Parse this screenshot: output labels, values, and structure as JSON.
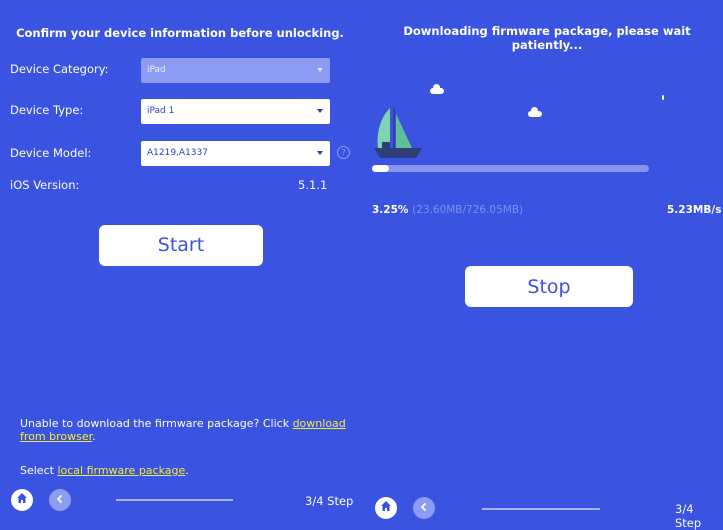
{
  "left_panel": {
    "heading": "Confirm your device information before unlocking.",
    "fields": [
      {
        "label": "Device Category:",
        "value": "iPad"
      },
      {
        "label": "Device Type:",
        "value": "iPad 1"
      },
      {
        "label": "Device Model:",
        "value": "A1219,A1337"
      }
    ],
    "ios_label": "iOS Version:",
    "ios_value": "5.1.1",
    "start_label": "Start",
    "note_prefix": "Unable to download the firmware package? Click ",
    "note_link": "download from browser",
    "note_suffix": ".",
    "select_prefix": "Select ",
    "select_link": "local firmware package",
    "select_suffix": ".",
    "step": "3/4 Step"
  },
  "right_panel": {
    "heading": "Downloading firmware package, please wait patiently...",
    "progress_fraction": 0.0325,
    "percent": "3.25%",
    "size": "(23.60MB/726.05MB)",
    "speed": "5.23MB/s",
    "stop_label": "Stop",
    "step": "3/4 Step"
  },
  "icons": {
    "home": "home-icon",
    "back": "back-chevron-icon",
    "help": "question-circle-icon",
    "boat": "sailboat-icon",
    "cloud": "cloud-icon"
  },
  "colors": {
    "background": "#3a53e0",
    "link": "#f2ec3a",
    "boat_sail": "#7fd3b0"
  }
}
